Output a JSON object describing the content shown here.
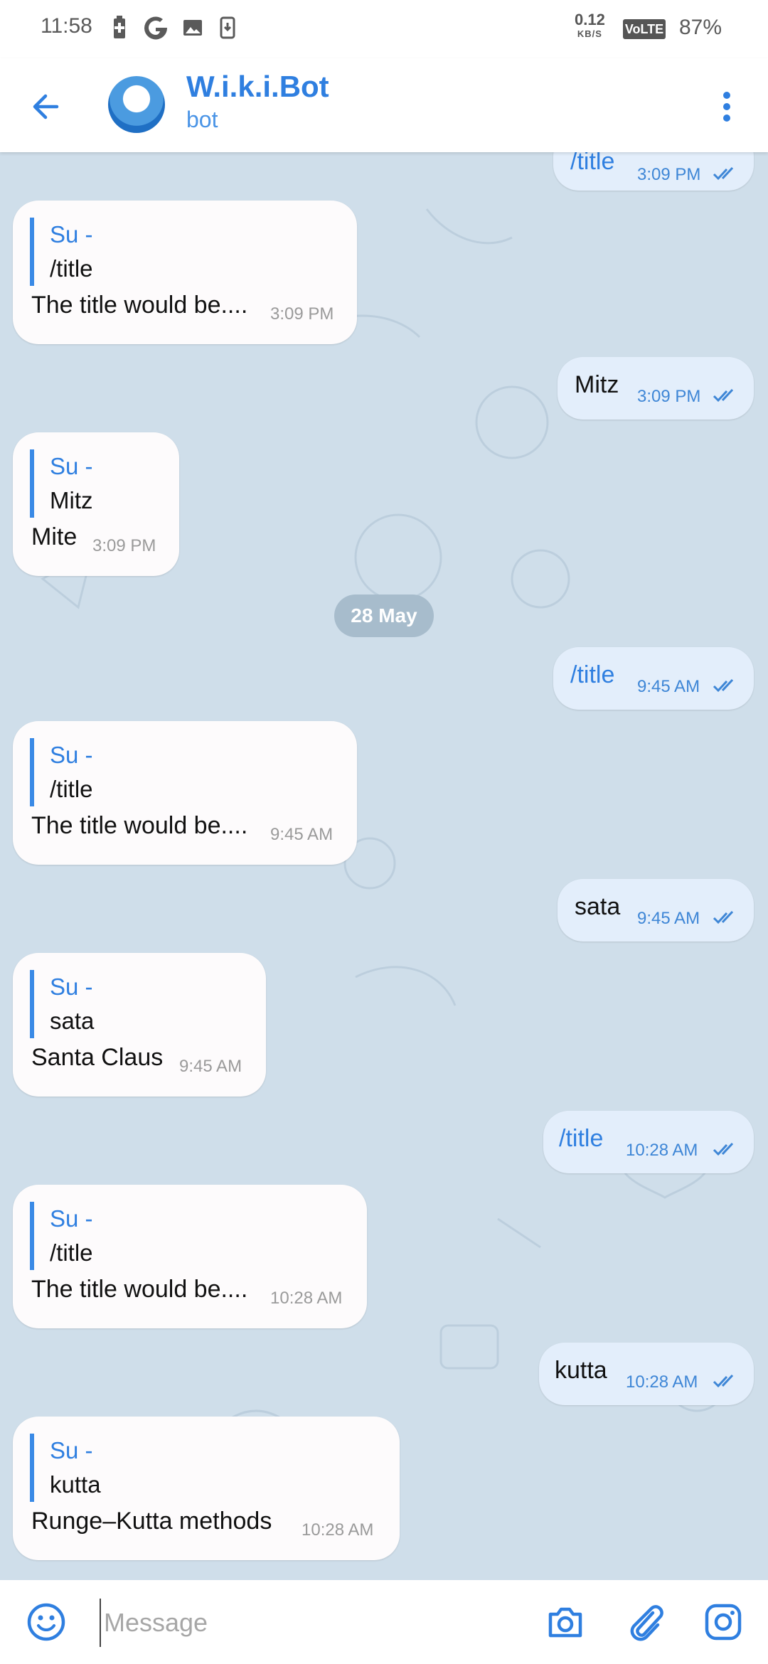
{
  "status_bar": {
    "time": "11:58",
    "net_speed": "0.12",
    "net_unit": "KB/S",
    "volte": "VoLTE",
    "battery": "87%"
  },
  "header": {
    "title": "W.i.k.i.Bot",
    "subtitle": "bot"
  },
  "date_chip": "28 May",
  "messages": [
    {
      "dir": "out",
      "text": "/title",
      "time": "3:09 PM"
    },
    {
      "dir": "in",
      "reply_name": "Su -",
      "reply_text": "/title",
      "text": "The title would be....",
      "time": "3:09 PM"
    },
    {
      "dir": "out",
      "text": "Mitz",
      "time": "3:09 PM"
    },
    {
      "dir": "in",
      "reply_name": "Su -",
      "reply_text": "Mitz",
      "text": "Mite",
      "time": "3:09 PM"
    },
    {
      "dir": "out",
      "text": "/title",
      "time": "9:45 AM"
    },
    {
      "dir": "in",
      "reply_name": "Su -",
      "reply_text": "/title",
      "text": "The title would be....",
      "time": "9:45 AM"
    },
    {
      "dir": "out",
      "text": "sata",
      "time": "9:45 AM"
    },
    {
      "dir": "in",
      "reply_name": "Su -",
      "reply_text": "sata",
      "text": "Santa Claus",
      "time": "9:45 AM"
    },
    {
      "dir": "out",
      "text": "/title",
      "time": "10:28 AM"
    },
    {
      "dir": "in",
      "reply_name": "Su -",
      "reply_text": "/title",
      "text": "The title would be....",
      "time": "10:28 AM"
    },
    {
      "dir": "out",
      "text": "kutta",
      "time": "10:28 AM"
    },
    {
      "dir": "in",
      "reply_name": "Su -",
      "reply_text": "kutta",
      "text": "Runge–Kutta methods",
      "time": "10:28 AM"
    }
  ],
  "input": {
    "placeholder": "Message"
  },
  "icons": {
    "back": "arrow-left-icon",
    "menu": "more-vertical-icon",
    "emoji": "emoji-icon",
    "camera": "camera-icon",
    "attach": "paperclip-icon",
    "instagram": "instagram-icon"
  },
  "colors": {
    "accent": "#2f7fe0",
    "chat_bg": "#cfdeea",
    "incoming": "#fdfbfc",
    "outgoing": "#e3eefb"
  }
}
